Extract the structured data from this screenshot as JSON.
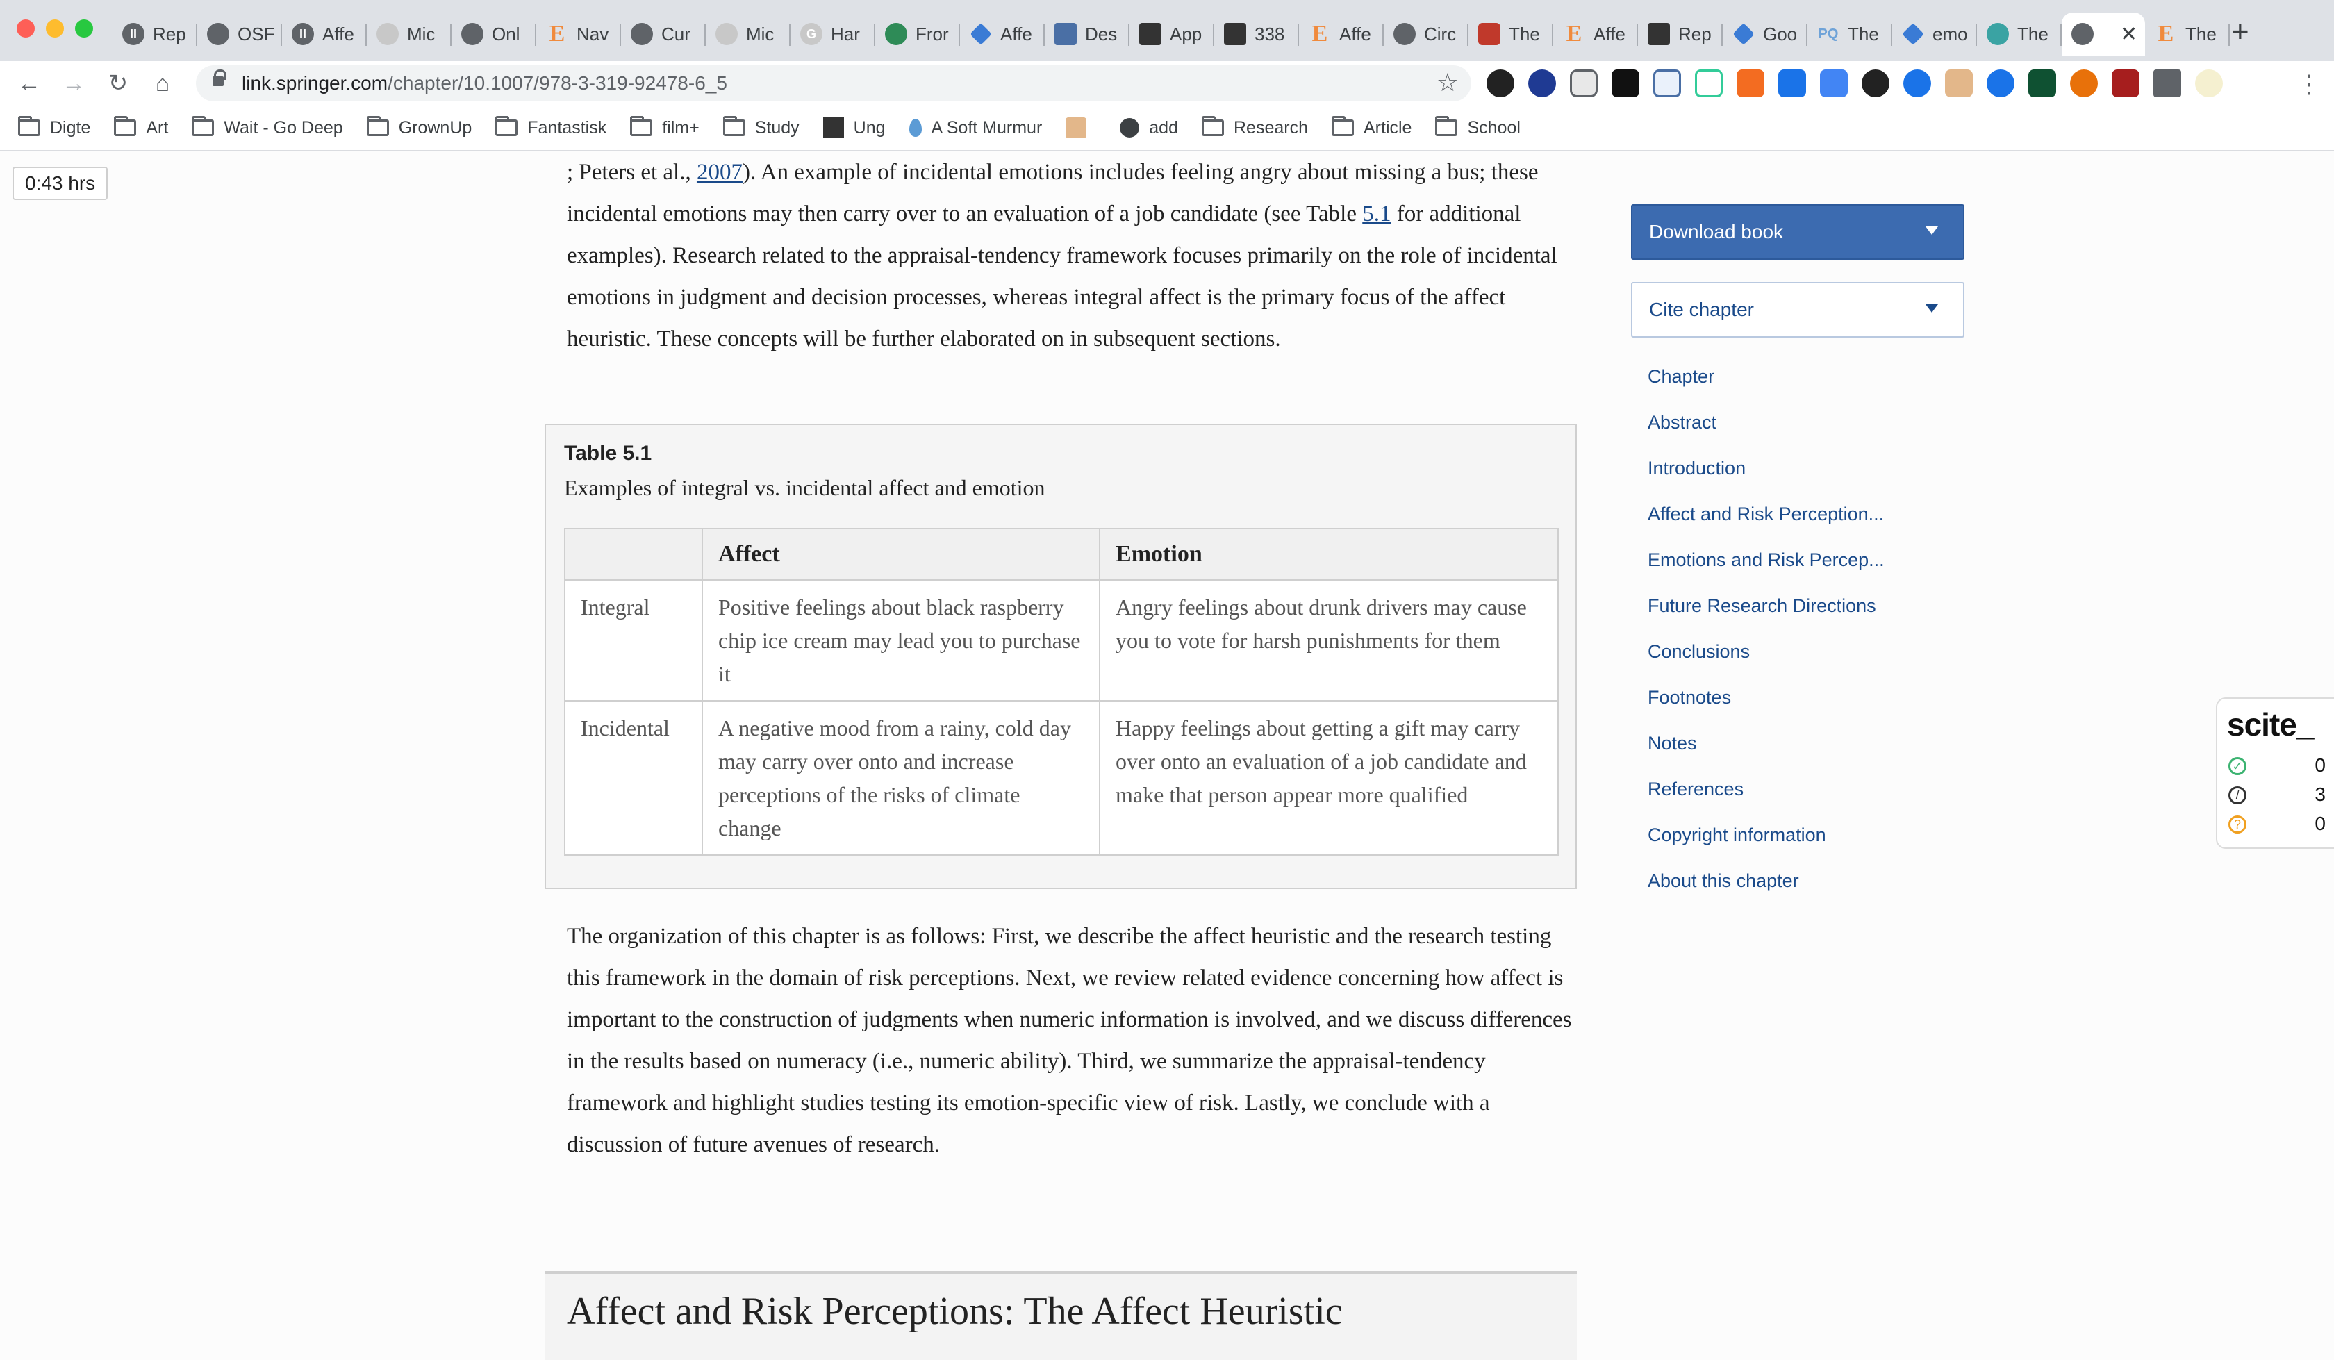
{
  "browser": {
    "tabs": [
      {
        "label": "Rep",
        "icon": "p-icon"
      },
      {
        "label": "OSF",
        "icon": "osf-icon"
      },
      {
        "label": "Affe",
        "icon": "p-icon"
      },
      {
        "label": "Mic",
        "icon": "globe-icon"
      },
      {
        "label": "Onl",
        "icon": "pen-icon"
      },
      {
        "label": "Nav",
        "icon": "e-icon"
      },
      {
        "label": "Cur",
        "icon": "s-icon"
      },
      {
        "label": "Mic",
        "icon": "globe-icon"
      },
      {
        "label": "Har",
        "icon": "google-icon"
      },
      {
        "label": "Fror",
        "icon": "bird-icon"
      },
      {
        "label": "Affe",
        "icon": "blue-diamond-icon"
      },
      {
        "label": "Des",
        "icon": "doc-icon"
      },
      {
        "label": "App",
        "icon": "square-icon"
      },
      {
        "label": "338",
        "icon": "square-icon"
      },
      {
        "label": "Affe",
        "icon": "e-icon"
      },
      {
        "label": "Circ",
        "icon": "figure-icon"
      },
      {
        "label": "The",
        "icon": "shield-icon"
      },
      {
        "label": "Affe",
        "icon": "e-icon"
      },
      {
        "label": "Rep",
        "icon": "lines-icon"
      },
      {
        "label": "Goo",
        "icon": "blue-diamond-icon"
      },
      {
        "label": "The",
        "icon": "pq-icon"
      },
      {
        "label": "emo",
        "icon": "blue-diamond-icon"
      },
      {
        "label": "The",
        "icon": "dots-icon"
      }
    ],
    "active_tab_icon": "springer-icon",
    "last_tab": {
      "label": "The",
      "icon": "e-icon"
    },
    "url_host": "link.springer.com",
    "url_path": "/chapter/10.1007/978-3-319-92478-6_5",
    "bookmarks": [
      {
        "label": "Digte",
        "icon": "folder-icon"
      },
      {
        "label": "Art",
        "icon": "folder-icon"
      },
      {
        "label": "Wait - Go Deep",
        "icon": "folder-icon"
      },
      {
        "label": "GrownUp",
        "icon": "folder-icon"
      },
      {
        "label": "Fantastisk",
        "icon": "folder-icon"
      },
      {
        "label": "film+",
        "icon": "folder-icon"
      },
      {
        "label": "Study",
        "icon": "folder-icon"
      },
      {
        "label": "Ung",
        "icon": "square-icon"
      },
      {
        "label": "A Soft Murmur",
        "icon": "drop-icon"
      },
      {
        "label": "",
        "icon": "robot-icon"
      },
      {
        "label": "add",
        "icon": "globe-icon"
      },
      {
        "label": "Research",
        "icon": "folder-icon"
      },
      {
        "label": "Article",
        "icon": "folder-icon"
      },
      {
        "label": "School",
        "icon": "folder-icon"
      }
    ]
  },
  "timer": "0:43 hrs",
  "article": {
    "p1_a": "; Peters et al., ",
    "p1_link1": "2007",
    "p1_b": "). An example of incidental emotions includes feeling angry about missing a bus; these incidental emotions may then carry over to an evaluation of a job candidate (see Table ",
    "p1_link2": "5.1",
    "p1_c": " for additional examples). Research related to the appraisal-tendency framework focuses primarily on the role of incidental emotions in judgment and decision processes, whereas integral affect is the primary focus of the affect heuristic. These concepts will be further elaborated on in subsequent sections.",
    "table": {
      "title": "Table 5.1",
      "caption": "Examples of integral vs. incidental affect and emotion",
      "headers": [
        "",
        "Affect",
        "Emotion"
      ],
      "rows": [
        [
          "Integral",
          "Positive feelings about black raspberry chip ice cream may lead you to purchase it",
          "Angry feelings about drunk drivers may cause you to vote for harsh punishments for them"
        ],
        [
          "Incidental",
          "A negative mood from a rainy, cold day may carry over onto and increase perceptions of the risks of climate change",
          "Happy feelings about getting a gift may carry over onto an evaluation of a job candidate and make that person appear more qualified"
        ]
      ]
    },
    "p2": "The organization of this chapter is as follows: First, we describe the affect heuristic and the research testing this framework in the domain of risk perceptions. Next, we review related evidence concerning how affect is important to the construction of judgments when numeric information is involved, and we discuss differences in the results based on numeracy (i.e., numeric ability). Third, we summarize the appraisal-tendency framework and highlight studies testing its emotion-specific view of risk. Lastly, we conclude with a discussion of future avenues of research.",
    "section_heading": "Affect and Risk Perceptions: The Affect Heuristic"
  },
  "sidebar": {
    "download_label": "Download book",
    "cite_label": "Cite chapter",
    "toc": [
      "Chapter",
      "Abstract",
      "Introduction",
      "Affect and Risk Perception...",
      "Emotions and Risk Percep...",
      "Future Research Directions",
      "Conclusions",
      "Footnotes",
      "Notes",
      "References",
      "Copyright information",
      "About this chapter"
    ]
  },
  "scite": {
    "brand": "scite_",
    "supporting": "0",
    "mentioning": "3",
    "contrasting": "0"
  },
  "colors": {
    "link": "#1a4a8a",
    "download_button": "#3c6bb0"
  }
}
